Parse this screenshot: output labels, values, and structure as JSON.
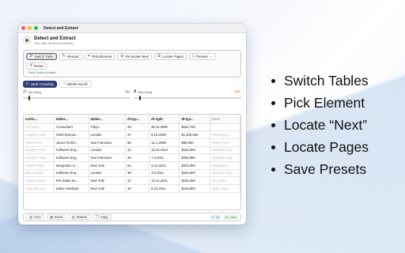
{
  "window": {
    "title": "Detect and Extract",
    "app_title": "Detect and Extract",
    "app_subtitle": "Your data, structured instantly"
  },
  "toolbar": {
    "switch_table": "Switch Table",
    "rescan": "Rescan",
    "pick_element": "Pick Element",
    "relocate_next": "Re-locate Next",
    "locate_pages": "Locate Pages",
    "presets": "Presets",
    "reset": "Reset",
    "status": "\"Next\" button located"
  },
  "crawl": {
    "start_label": "Start Crawling",
    "infinite_label": "Infinite Scroll",
    "min_delay_label": "Min Delay",
    "min_delay_value": "1s",
    "max_delay_label": "Max Delay",
    "max_delay_value": "20s",
    "min_delay_level": 0.05,
    "max_delay_level": 0.05
  },
  "table": {
    "headers": [
      "sortin...",
      "tables...",
      "tables...",
      "dt-typ...",
      "dt-right",
      "dt-typ...",
      "(Rest"
    ],
    "rows": [
      [
        "Airi Satou",
        "Accountant",
        "Tokyo",
        "33",
        "28.11.2008",
        "$162,700",
        ""
      ],
      [
        "Angelica Ram...",
        "Chief Executi...",
        "London",
        "47",
        "9.10.2009",
        "$1,200,000",
        "Chief Execu..."
      ],
      [
        "Ashton Cox",
        "Junior Techni...",
        "San Francisco",
        "66",
        "12.1.2009",
        "$86,000",
        "Junior Tech..."
      ],
      [
        "Bradley Greer",
        "Software Eng...",
        "London",
        "41",
        "13.10.2012",
        "$132,000",
        "Software Eng..."
      ],
      [
        "Brenden Wag...",
        "Software Eng...",
        "San Francisco",
        "28",
        "7.6.2011",
        "$206,850",
        "Software Eng..."
      ],
      [
        "Brielle Willia...",
        "Integration S...",
        "New York",
        "61",
        "2.12.2012",
        "$372,000",
        "Integration..."
      ],
      [
        "Bruno Nash",
        "Software Eng...",
        "London",
        "38",
        "3.5.2011",
        "$163,500",
        "Software Eng..."
      ],
      [
        "Caesar Vance",
        "Pre-Sales Su...",
        "New York",
        "21",
        "12.12.2011",
        "$106,450",
        "Pre-Sales..."
      ],
      [
        "Cara Stevens",
        "Sales Assistant",
        "New York",
        "46",
        "6.12.2011",
        "$145,600",
        "Sales Assis..."
      ]
    ]
  },
  "export": {
    "csv": "CSV",
    "excel": "Excel",
    "sheets": "Sheets",
    "copy": "Copy",
    "badge_a": "1 · 10",
    "badge_b": "10 · rows"
  },
  "features": [
    "Switch Tables",
    "Pick Element",
    "Locate “Next”",
    "Locate Pages",
    "Save Presets"
  ],
  "colors": {
    "primary": "#2c3e73",
    "success": "#3a8a3a",
    "accent_warn": "#c27a12"
  }
}
